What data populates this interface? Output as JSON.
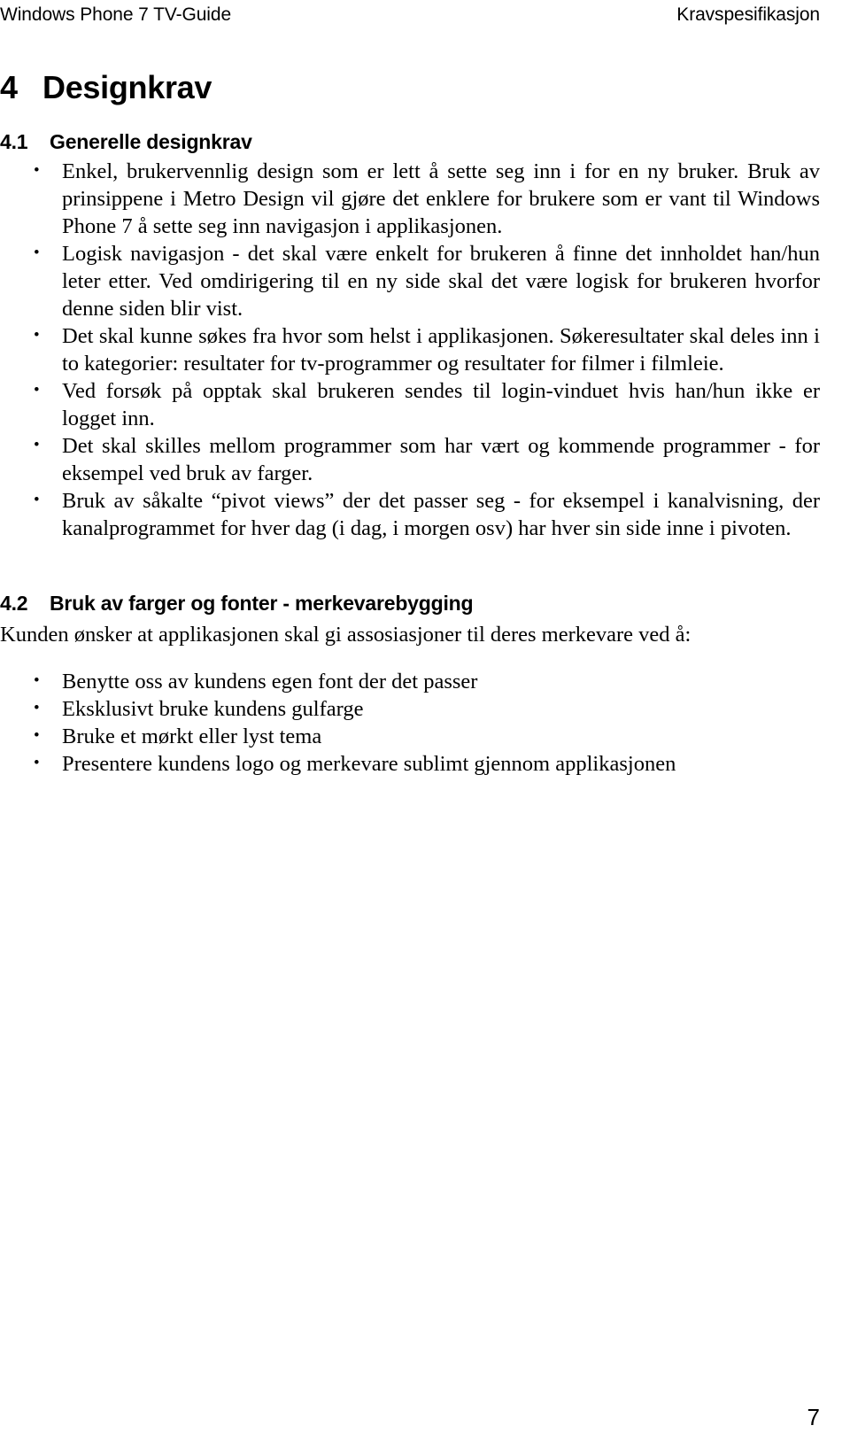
{
  "header": {
    "left": "Windows Phone 7 TV-Guide",
    "right": "Kravspesifikasjon"
  },
  "chapter": {
    "number": "4",
    "title": "Designkrav"
  },
  "sections": [
    {
      "number": "4.1",
      "title": "Generelle designkrav",
      "bullets": [
        "Enkel, brukervennlig design som er lett å sette seg inn i for en ny bruker. Bruk av prinsippene i Metro Design vil gjøre det enklere for brukere som er vant til Windows Phone 7 å sette seg inn navigasjon i applikasjonen.",
        "Logisk navigasjon - det skal være enkelt for brukeren å finne det innholdet han/hun leter etter. Ved omdirigering til en ny side skal det være logisk for brukeren hvorfor denne siden blir vist.",
        "Det skal kunne søkes fra hvor som helst i applikasjonen. Søkeresultater skal deles inn i to kategorier: resultater for tv-programmer og resultater for filmer i filmleie.",
        "Ved forsøk på opptak skal brukeren sendes til login-vinduet hvis han/hun ikke er logget inn.",
        "Det skal skilles mellom programmer som har vært og kommende programmer - for eksempel ved bruk av farger.",
        "Bruk av såkalte “pivot views” der det passer seg - for eksempel i kanalvisning, der kanalprogrammet for hver dag (i dag, i morgen osv) har hver sin side inne i pivoten."
      ]
    },
    {
      "number": "4.2",
      "title": "Bruk av farger og fonter - merkevarebygging",
      "intro": "Kunden ønsker at applikasjonen skal gi assosiasjoner til deres merkevare ved å:",
      "bullets": [
        "Benytte oss av kundens egen font der det passer",
        "Eksklusivt bruke kundens gulfarge",
        "Bruke et mørkt eller lyst tema",
        "Presentere kundens logo og merkevare sublimt gjennom applikasjonen"
      ]
    }
  ],
  "footer": {
    "page_number": "7"
  }
}
